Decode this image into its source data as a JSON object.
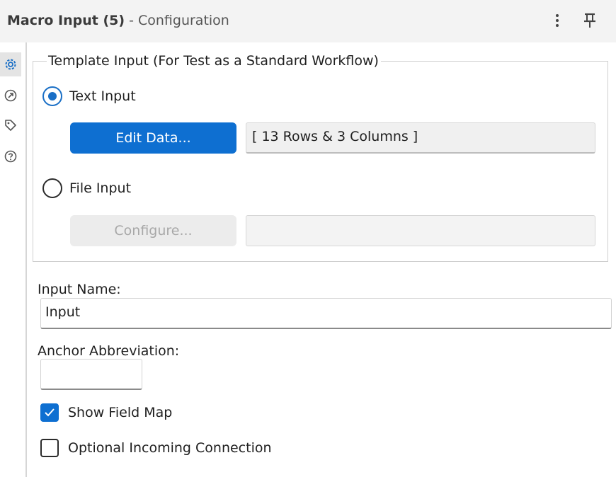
{
  "header": {
    "title_main": "Macro Input (5)",
    "title_sub": " - Configuration",
    "menu_icon": "kebab-vertical-icon",
    "pin_icon": "pin-icon"
  },
  "rail": {
    "items": [
      {
        "icon": "gear-icon",
        "active": true
      },
      {
        "icon": "connection-arrow-icon",
        "active": false
      },
      {
        "icon": "tag-icon",
        "active": false
      },
      {
        "icon": "help-icon",
        "active": false
      }
    ]
  },
  "template_input": {
    "legend": "Template Input (For Test as a Standard Workflow)",
    "text_input_label": "Text Input",
    "text_input_selected": true,
    "edit_data_label": "Edit Data...",
    "data_summary": "[ 13 Rows & 3 Columns ]",
    "file_input_label": "File Input",
    "file_input_selected": false,
    "configure_label": "Configure...",
    "file_path": ""
  },
  "input_name": {
    "label": "Input Name:",
    "value": "Input"
  },
  "anchor_abbreviation": {
    "label": "Anchor Abbreviation:",
    "value": ""
  },
  "options": {
    "show_field_map_label": "Show Field Map",
    "show_field_map_checked": true,
    "optional_connection_label": "Optional Incoming Connection",
    "optional_connection_checked": false
  },
  "colors": {
    "accent": "#0e6fd1",
    "header_bg": "#f3f3f3",
    "disabled_text": "#a8a8a8"
  }
}
